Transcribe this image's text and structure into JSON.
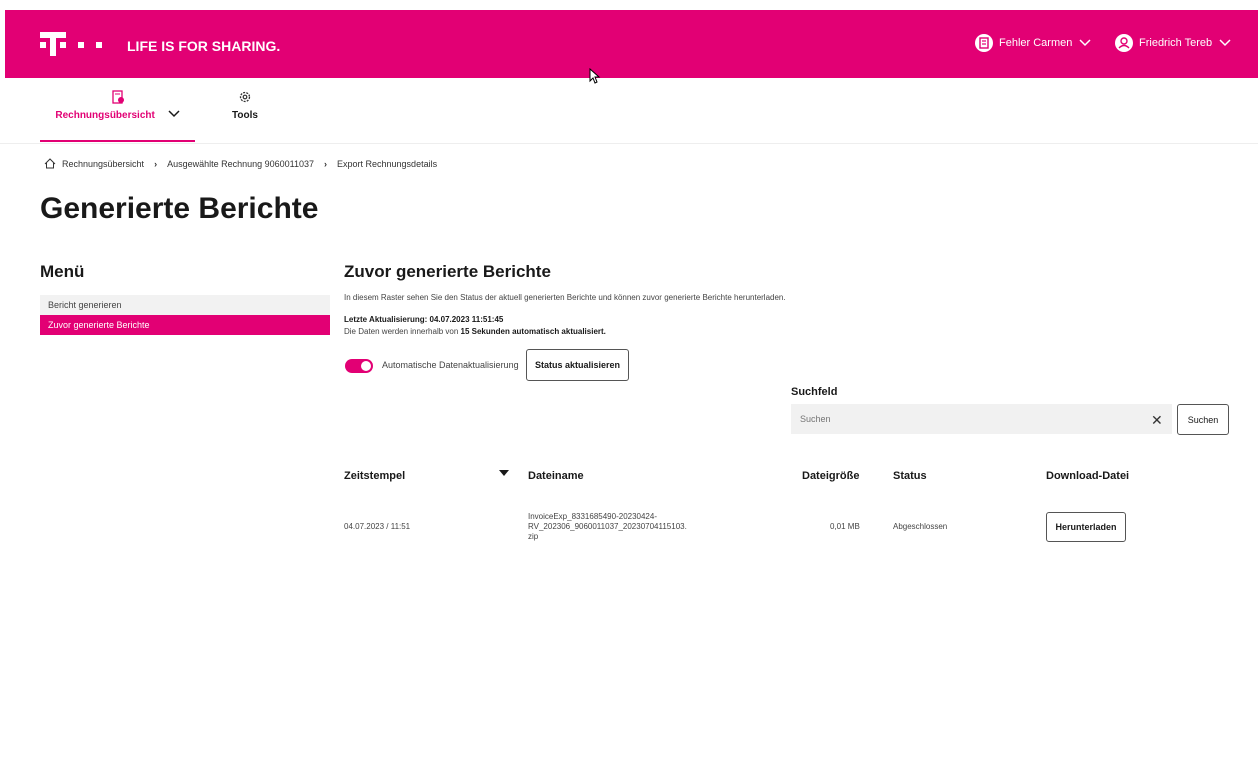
{
  "brand": {
    "slogan": "LIFE IS FOR SHARING.",
    "color": "#e20074"
  },
  "header": {
    "account1": {
      "label": "Fehler Carmen",
      "icon": "building-icon"
    },
    "account2": {
      "label": "Friedrich Tereb",
      "icon": "user-icon"
    }
  },
  "nav": {
    "items": [
      {
        "label": "Rechnungsübersicht",
        "icon": "invoice-icon",
        "active": true
      },
      {
        "label": "Tools",
        "icon": "gear-icon",
        "active": false
      }
    ]
  },
  "breadcrumb": {
    "items": [
      "Rechnungsübersicht",
      "Ausgewählte Rechnung 9060011037",
      "Export Rechnungsdetails"
    ]
  },
  "page": {
    "title": "Generierte Berichte"
  },
  "menu": {
    "title": "Menü",
    "items": [
      "Bericht generieren",
      "Zuvor generierte Berichte"
    ]
  },
  "section": {
    "title": "Zuvor generierte Berichte",
    "description": "In diesem Raster sehen Sie den Status der aktuell generierten Berichte und können zuvor generierte Berichte herunterladen.",
    "last_update": "Letzte Aktualisierung: 04.07.2023 11:51:45",
    "auto_note_pre": "Die Daten werden innerhalb von ",
    "auto_note_bold": "15 Sekunden automatisch aktualisiert.",
    "toggle_label": "Automatische Datenaktualisierung",
    "toggle_on": true,
    "status_button": "Status aktualisieren"
  },
  "search": {
    "label": "Suchfeld",
    "placeholder": "Suchen",
    "button": "Suchen"
  },
  "table": {
    "headers": [
      "Zeitstempel",
      "Dateiname",
      "Dateigröße",
      "Status",
      "Download-Datei"
    ],
    "rows": [
      {
        "timestamp": "04.07.2023 / 11:51",
        "filename_lines": [
          "InvoiceExp_8331685490-20230424-",
          "RV_202306_9060011037_20230704115103.",
          "zip"
        ],
        "size": "0,01 MB",
        "status": "Abgeschlossen",
        "download": "Herunterladen"
      }
    ]
  }
}
